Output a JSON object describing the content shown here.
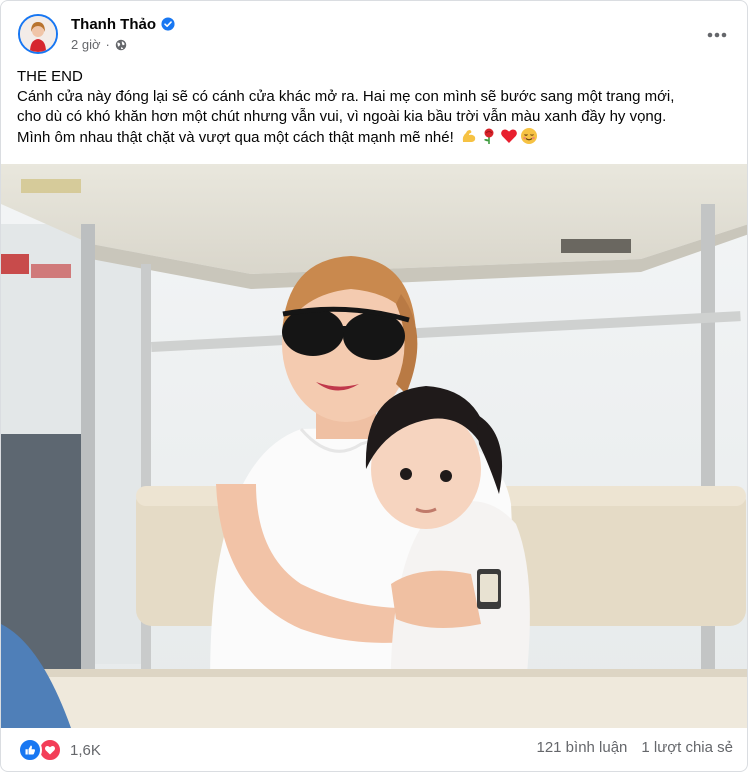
{
  "post": {
    "author": "Thanh Thảo",
    "time": "2 giờ",
    "caption": {
      "line1": "THE END",
      "line2": "Cánh cửa này đóng lại sẽ có cánh cửa khác mở ra. Hai mẹ con mình sẽ bước sang một trang mới,",
      "line3": "cho dù có khó khăn hơn một chút nhưng vẫn vui, vì ngoài kia bầu trời vẫn màu xanh đầy hy vọng.",
      "line4": "Mình ôm nhau thật chặt và vượt qua một cách thật mạnh mẽ nhé!"
    },
    "emojis": [
      "flexed-biceps-icon",
      "rose-icon",
      "red-heart-icon",
      "relieved-face-icon"
    ]
  },
  "footer": {
    "reaction_count": "1,6K",
    "comments": "121 bình luận",
    "shares": "1 lượt chia sẻ"
  },
  "colors": {
    "brand_blue": "#1877f2",
    "love_red": "#f33e58",
    "secondary_text": "#65676b"
  }
}
